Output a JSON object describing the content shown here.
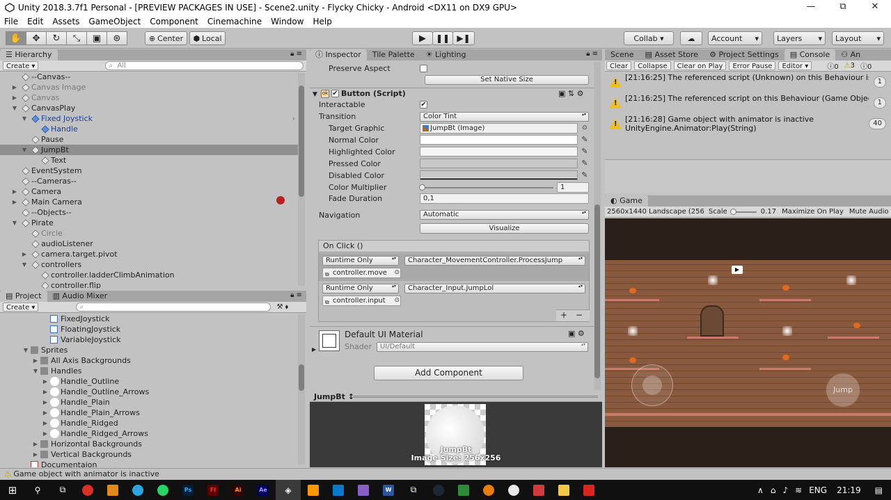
{
  "window": {
    "title": "Unity 2018.3.7f1 Personal - [PREVIEW PACKAGES IN USE] - Scene2.unity - Flycky Chicky - Android <DX11 on DX9 GPU>",
    "minimize": "—",
    "maximize": "⧉",
    "close": "✕"
  },
  "menu": [
    "File",
    "Edit",
    "Assets",
    "GameObject",
    "Component",
    "Cinemachine",
    "Window",
    "Help"
  ],
  "toolbar": {
    "pivot_center": "Center",
    "pivot_local": "Local",
    "collab": "Collab ▾",
    "account": "Account",
    "layers": "Layers",
    "layout": "Layout"
  },
  "hierarchy": {
    "tab": "Hierarchy",
    "create": "Create",
    "search_placeholder": "All",
    "items": [
      {
        "label": "--Canvas--",
        "indent": 0,
        "arrow": "",
        "style": ""
      },
      {
        "label": "Canvas Image",
        "indent": 0,
        "arrow": "▶",
        "style": "grey"
      },
      {
        "label": "Canvas",
        "indent": 0,
        "arrow": "▶",
        "style": "grey"
      },
      {
        "label": "CanvasPlay",
        "indent": 0,
        "arrow": "▼",
        "style": ""
      },
      {
        "label": "Fixed Joystick",
        "indent": 1,
        "arrow": "▼",
        "style": "blue"
      },
      {
        "label": "Handle",
        "indent": 2,
        "arrow": "",
        "style": "blue"
      },
      {
        "label": "Pause",
        "indent": 1,
        "arrow": "",
        "style": ""
      },
      {
        "label": "JumpBt",
        "indent": 1,
        "arrow": "▼",
        "style": "sel"
      },
      {
        "label": "Text",
        "indent": 2,
        "arrow": "",
        "style": ""
      },
      {
        "label": "EventSystem",
        "indent": 0,
        "arrow": "",
        "style": ""
      },
      {
        "label": "--Cameras--",
        "indent": 0,
        "arrow": "",
        "style": ""
      },
      {
        "label": "Camera",
        "indent": 0,
        "arrow": "▶",
        "style": ""
      },
      {
        "label": "Main Camera",
        "indent": 0,
        "arrow": "▶",
        "style": ""
      },
      {
        "label": "--Objects--",
        "indent": 0,
        "arrow": "",
        "style": ""
      },
      {
        "label": "Pirate",
        "indent": 0,
        "arrow": "▼",
        "style": ""
      },
      {
        "label": "Circle",
        "indent": 1,
        "arrow": "",
        "style": "grey"
      },
      {
        "label": "audioListener",
        "indent": 1,
        "arrow": "",
        "style": ""
      },
      {
        "label": "camera.target.pivot",
        "indent": 1,
        "arrow": "▶",
        "style": ""
      },
      {
        "label": "controllers",
        "indent": 1,
        "arrow": "▼",
        "style": ""
      },
      {
        "label": "controller.ladderClimbAnimation",
        "indent": 2,
        "arrow": "",
        "style": ""
      },
      {
        "label": "controller.flip",
        "indent": 2,
        "arrow": "",
        "style": ""
      }
    ]
  },
  "project": {
    "tabs": [
      "Project",
      "Audio Mixer"
    ],
    "create": "Create",
    "items": [
      {
        "label": "FixedJoystick",
        "indent": 3,
        "arrow": "",
        "icon": "script"
      },
      {
        "label": "FloatingJoystick",
        "indent": 3,
        "arrow": "",
        "icon": "script"
      },
      {
        "label": "VariableJoystick",
        "indent": 3,
        "arrow": "",
        "icon": "script"
      },
      {
        "label": "Sprites",
        "indent": 1,
        "arrow": "▼",
        "icon": "folder"
      },
      {
        "label": "All Axis Backgrounds",
        "indent": 2,
        "arrow": "▶",
        "icon": "folder"
      },
      {
        "label": "Handles",
        "indent": 2,
        "arrow": "▼",
        "icon": "folder"
      },
      {
        "label": "Handle_Outline",
        "indent": 3,
        "arrow": "▶",
        "icon": "circle"
      },
      {
        "label": "Handle_Outline_Arrows",
        "indent": 3,
        "arrow": "▶",
        "icon": "circle"
      },
      {
        "label": "Handle_Plain",
        "indent": 3,
        "arrow": "▶",
        "icon": "circle"
      },
      {
        "label": "Handle_Plain_Arrows",
        "indent": 3,
        "arrow": "▶",
        "icon": "circle"
      },
      {
        "label": "Handle_Ridged",
        "indent": 3,
        "arrow": "▶",
        "icon": "circle"
      },
      {
        "label": "Handle_Ridged_Arrows",
        "indent": 3,
        "arrow": "▶",
        "icon": "circle"
      },
      {
        "label": "Horizontal Backgrounds",
        "indent": 2,
        "arrow": "▶",
        "icon": "folder"
      },
      {
        "label": "Vertical Backgrounds",
        "indent": 2,
        "arrow": "▶",
        "icon": "folder"
      },
      {
        "label": "Documentaion",
        "indent": 1,
        "arrow": "",
        "icon": "pdf"
      }
    ]
  },
  "inspector": {
    "tabs": [
      "Inspector",
      "Tile Palette",
      "Lighting"
    ],
    "preserve_aspect": "Preserve Aspect",
    "set_native_size": "Set Native Size",
    "component_title": "Button (Script)",
    "interactable": "Interactable",
    "transition": "Transition",
    "transition_value": "Color Tint",
    "target_graphic": "Target Graphic",
    "target_graphic_value": "JumpBt (Image)",
    "normal_color": "Normal Color",
    "highlighted_color": "Highlighted Color",
    "pressed_color": "Pressed Color",
    "disabled_color": "Disabled Color",
    "color_multiplier": "Color Multiplier",
    "color_multiplier_value": "1",
    "fade_duration": "Fade Duration",
    "fade_duration_value": "0,1",
    "navigation": "Navigation",
    "navigation_value": "Automatic",
    "visualize": "Visualize",
    "on_click": "On Click ()",
    "events": [
      {
        "mode": "Runtime Only",
        "function": "Character_MovementController.ProcessJump",
        "object": "controller.move"
      },
      {
        "mode": "Runtime Only",
        "function": "Character_Input.JumpLol",
        "object": "controller.input"
      }
    ],
    "plus": "+",
    "minus": "−",
    "material_name": "Default UI Material",
    "shader_label": "Shader",
    "shader_value": "UI/Default",
    "add_component": "Add Component",
    "preview_title": "JumpBt ↕",
    "preview_name": "JumpBt",
    "preview_size": "Image Size: 256x256"
  },
  "console": {
    "tabs": [
      "Scene",
      "Asset Store",
      "Project Settings",
      "Console",
      "An"
    ],
    "buttons": [
      "Clear",
      "Collapse",
      "Clear on Play",
      "Error Pause",
      "Editor ▾"
    ],
    "counts": {
      "info": "0",
      "warn": "3",
      "error": "0"
    },
    "logs": [
      {
        "text": "[21:16:25] The referenced script (Unknown) on this Behaviour is missin",
        "text2": "",
        "count": "1"
      },
      {
        "text": "[21:16:25] The referenced script on this Behaviour (Game Object 'Pir",
        "text2": "",
        "count": "1"
      },
      {
        "text": "[21:16:28] Game object with animator is inactive",
        "text2": "UnityEngine.Animator:Play(String)",
        "count": "40"
      }
    ]
  },
  "game": {
    "tab": "Game",
    "resolution": "2560x1440 Landscape (256",
    "scale_label": "Scale",
    "scale_value": "0.17",
    "maximize": "Maximize On Play",
    "mute": "Mute Audio",
    "jump_label": "Jump"
  },
  "status": "Game object with animator is inactive",
  "taskbar": {
    "lang": "ENG",
    "time": "21:19"
  },
  "colors": {
    "selection": "#8f8f8f",
    "warning": "#f0c020",
    "brick": "#8a5a3f"
  }
}
